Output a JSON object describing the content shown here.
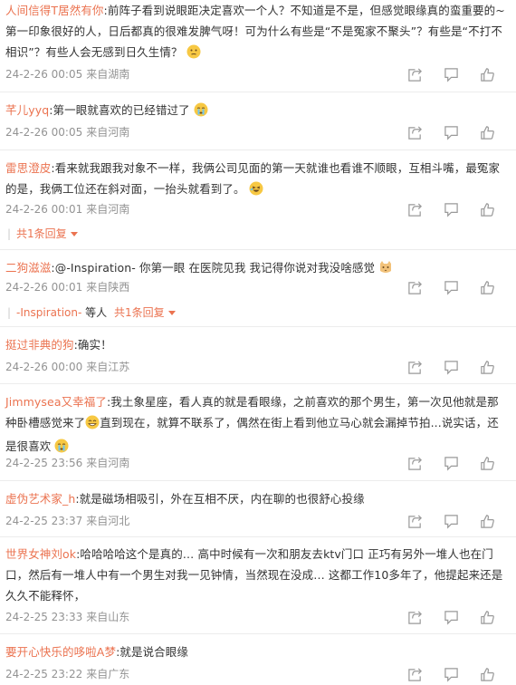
{
  "comments": [
    {
      "user": "人间信得T居然有你",
      "sep": ":",
      "text": "前阵子看到说眼距决定喜欢一个人？不知道是不是，但感觉眼缘真的蛮重要的~第一印象很好的人，日后都真的很难发脾气呀！可为什么有些是“不是冤家不聚头”？有些是“不打不相识”？有些人会无感到日久生情？",
      "emoji": "thinking-emoji",
      "time": "24-2-26 00:05",
      "source": "来自湖南"
    },
    {
      "user": "芊儿yyq",
      "sep": ":",
      "text": "第一眼就喜欢的已经错过了",
      "emoji": "cry-emoji",
      "time": "24-2-26 00:05",
      "source": "来自河南"
    },
    {
      "user": "雷思澄皮",
      "sep": ":",
      "text": "看来就我跟我对象不一样，我俩公司见面的第一天就谁也看谁不顺眼，互相斗嘴，最冤家的是，我俩工位还在斜对面，一抬头就看到了。",
      "emoji": "laugh-emoji",
      "time": "24-2-26 00:01",
      "source": "来自河南",
      "reply_count_label": "共1条回复"
    },
    {
      "user": "二狗滋滋",
      "sep": ":",
      "text": "@-Inspiration- 你第一眼 在医院见我 我记得你说对我没啥感觉",
      "emoji": "cat-emoji",
      "time": "24-2-26 00:01",
      "source": "来自陕西",
      "reply_user": "-Inspiration-",
      "reply_mid": "等人",
      "reply_count_label": "共1条回复"
    },
    {
      "user": "挺过非典的狗",
      "sep": ":",
      "text": "确实！",
      "time": "24-2-26 00:00",
      "source": "来自江苏"
    },
    {
      "user": "Jimmysea又幸福了",
      "sep": ":",
      "text": "我土象星座，看人真的就是看眼缘，之前喜欢的那个男生，第一次见他就是那种卧槽感觉来了",
      "emoji": "grin-emoji",
      "text2": "直到现在，就算不联系了，偶然在街上看到他立马心就会漏掉节拍...说实话，还是很喜欢",
      "emoji2": "cry-emoji",
      "time": "24-2-25 23:56",
      "source": "来自河南"
    },
    {
      "user": "虚伪艺术家_h",
      "sep": ":",
      "text": "就是磁场相吸引，外在互相不厌，内在聊的也很舒心投缘",
      "time": "24-2-25 23:37",
      "source": "来自河北"
    },
    {
      "user": "世界女神刘ok",
      "sep": ":",
      "text": "哈哈哈哈这个是真的… 高中时候有一次和朋友去ktv门口 正巧有另外一堆人也在门口，然后有一堆人中有一个男生对我一见钟情，当然现在没成… 这都工作10多年了，他提起来还是久久不能释怀，",
      "time": "24-2-25 23:33",
      "source": "来自山东"
    },
    {
      "user": "要开心快乐的哆啦A梦",
      "sep": ":",
      "text": "就是说合眼缘",
      "time": "24-2-25 23:22",
      "source": "来自广东"
    }
  ],
  "icons": {
    "share": "share-icon",
    "comment": "comment-icon",
    "like": "like-icon"
  },
  "colors": {
    "username": "#eb7350",
    "meta": "#939393",
    "text": "#333333"
  }
}
